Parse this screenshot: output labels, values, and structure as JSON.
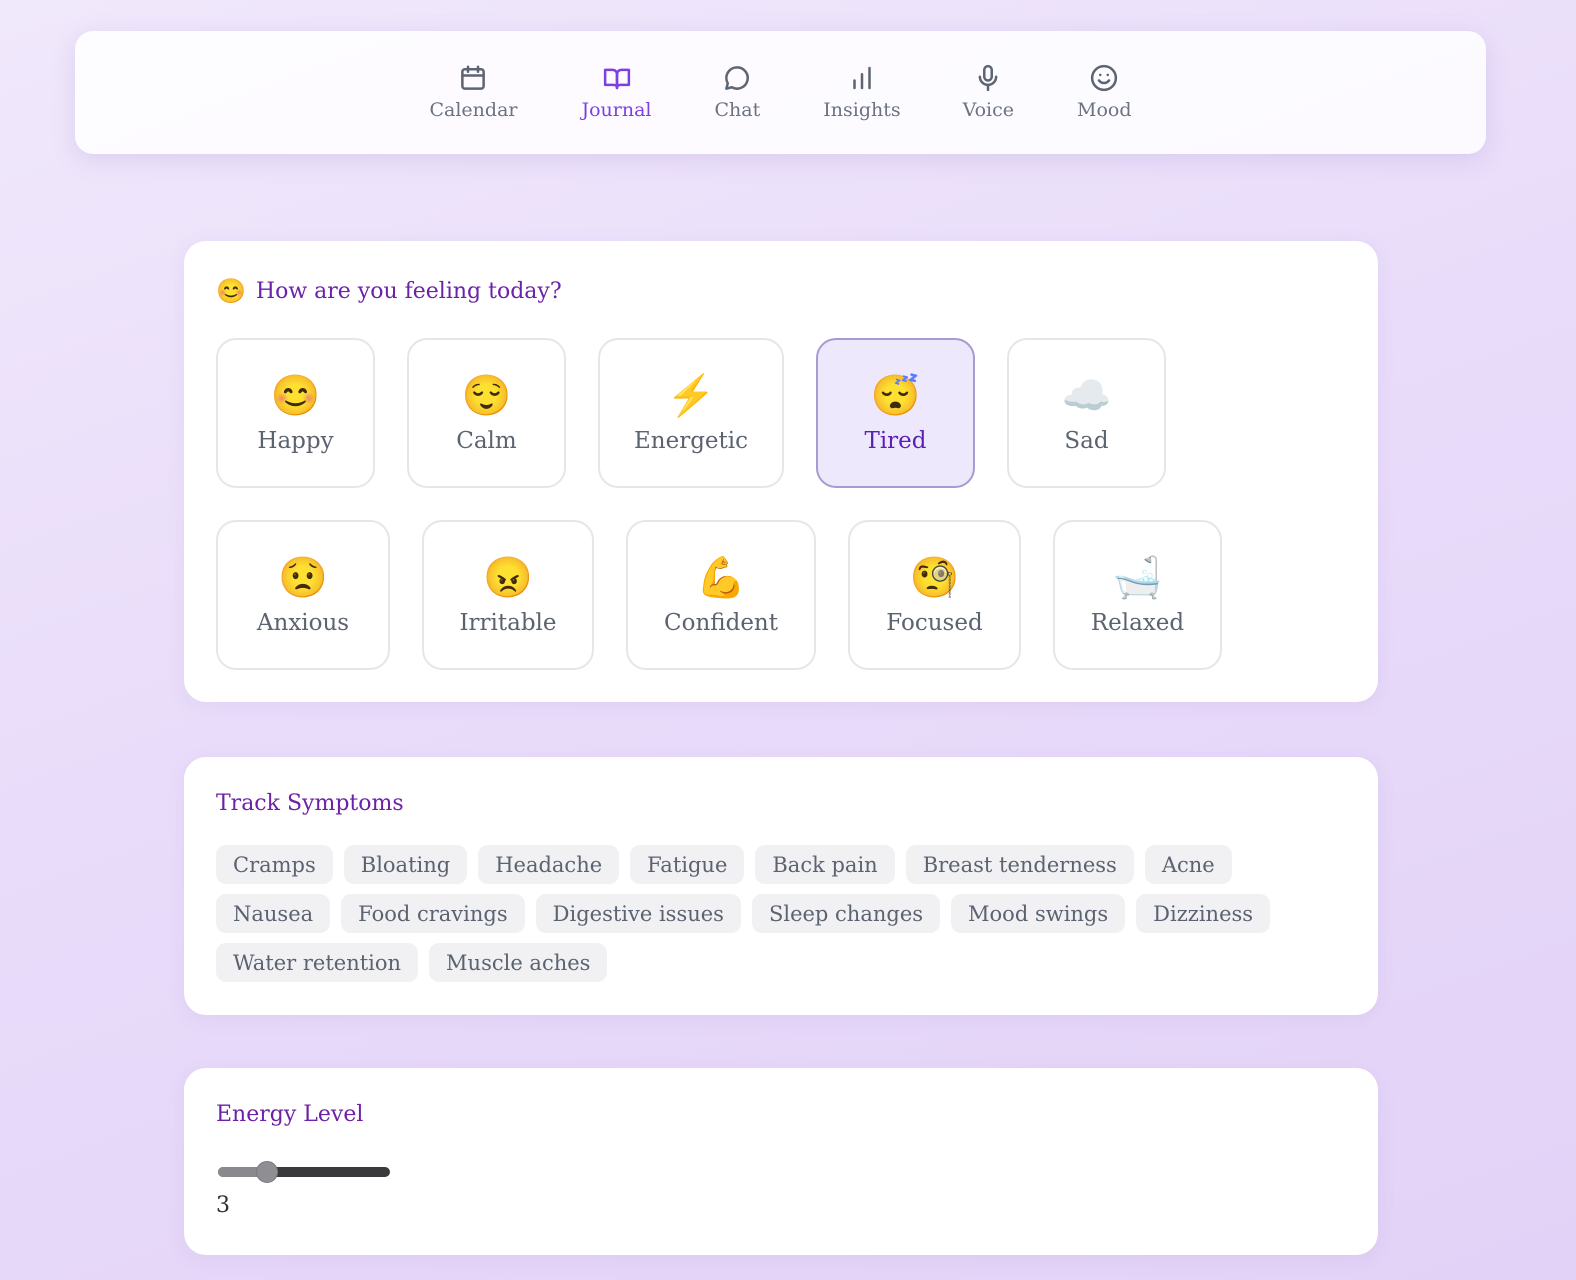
{
  "nav": {
    "items": [
      {
        "label": "Calendar",
        "icon": "calendar-icon",
        "active": false
      },
      {
        "label": "Journal",
        "icon": "book-open-icon",
        "active": true
      },
      {
        "label": "Chat",
        "icon": "chat-bubble-icon",
        "active": false
      },
      {
        "label": "Insights",
        "icon": "bar-chart-icon",
        "active": false
      },
      {
        "label": "Voice",
        "icon": "microphone-icon",
        "active": false
      },
      {
        "label": "Mood",
        "icon": "smiley-icon",
        "active": false
      }
    ],
    "active_color": "#7b3fe4"
  },
  "mood": {
    "title_emoji": "😊",
    "title": "How are you feeling today?",
    "options": [
      {
        "emoji": "😊",
        "label": "Happy",
        "selected": false
      },
      {
        "emoji": "😌",
        "label": "Calm",
        "selected": false
      },
      {
        "emoji": "⚡",
        "label": "Energetic",
        "selected": false
      },
      {
        "emoji": "😴",
        "label": "Tired",
        "selected": true
      },
      {
        "emoji": "☁️",
        "label": "Sad",
        "selected": false
      },
      {
        "emoji": "😟",
        "label": "Anxious",
        "selected": false
      },
      {
        "emoji": "😠",
        "label": "Irritable",
        "selected": false
      },
      {
        "emoji": "💪",
        "label": "Confident",
        "selected": false
      },
      {
        "emoji": "🧐",
        "label": "Focused",
        "selected": false
      },
      {
        "emoji": "🛁",
        "label": "Relaxed",
        "selected": false
      }
    ]
  },
  "symptoms": {
    "title": "Track Symptoms",
    "items": [
      "Cramps",
      "Bloating",
      "Headache",
      "Fatigue",
      "Back pain",
      "Breast tenderness",
      "Acne",
      "Nausea",
      "Food cravings",
      "Digestive issues",
      "Sleep changes",
      "Mood swings",
      "Dizziness",
      "Water retention",
      "Muscle aches"
    ]
  },
  "energy": {
    "title": "Energy Level",
    "value": "3",
    "slider_fraction": 0.25
  },
  "colors": {
    "heading": "#6b21a8",
    "selected_bg": "#ede8fc"
  }
}
